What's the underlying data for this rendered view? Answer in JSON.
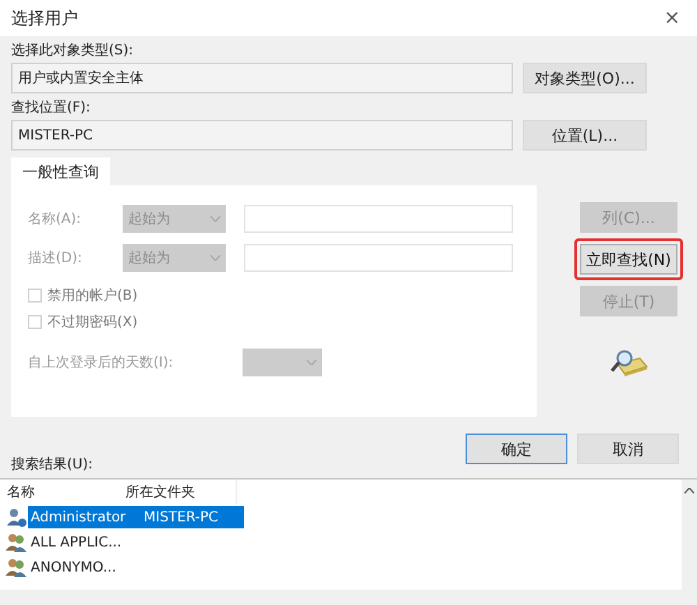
{
  "window": {
    "title": "选择用户",
    "close": "×"
  },
  "object_type": {
    "label": "选择此对象类型(S):",
    "value": "用户或内置安全主体",
    "button": "对象类型(O)..."
  },
  "location": {
    "label": "查找位置(F):",
    "value": "MISTER-PC",
    "button": "位置(L)..."
  },
  "tabs": [
    {
      "label": "一般性查询",
      "selected": true
    }
  ],
  "query_rows": [
    {
      "label": "名称(A):",
      "combo": "起始为",
      "disabled": true
    },
    {
      "label": "描述(D):",
      "combo": "起始为",
      "disabled": true
    }
  ],
  "checkboxes": [
    {
      "label": "禁用的帐户(B)",
      "checked": false,
      "disabled": true
    },
    {
      "label": "不过期密码(X)",
      "checked": false,
      "disabled": true
    }
  ],
  "days_since_logon": {
    "label": "自上次登录后的天数(I):",
    "disabled": true
  },
  "side_buttons": [
    {
      "label": "列(C)...",
      "disabled": true,
      "highlighted": false
    },
    {
      "label": "立即查找(N)",
      "disabled": false,
      "highlighted": true
    },
    {
      "label": "停止(T)",
      "disabled": true,
      "highlighted": false
    }
  ],
  "dialog_buttons": [
    {
      "label": "确定",
      "default": true
    },
    {
      "label": "取消",
      "default": false
    }
  ],
  "results": {
    "label": "搜索结果(U):",
    "columns": [
      "名称",
      "所在文件夹"
    ],
    "rows": [
      {
        "name": "Administrator",
        "folder": "MISTER-PC",
        "selected": true,
        "kind": "user"
      },
      {
        "name": "ALL APPLIC...",
        "selected": false,
        "kind": "group"
      },
      {
        "name": "ANONYMO...",
        "selected": false,
        "kind": "group"
      }
    ]
  }
}
